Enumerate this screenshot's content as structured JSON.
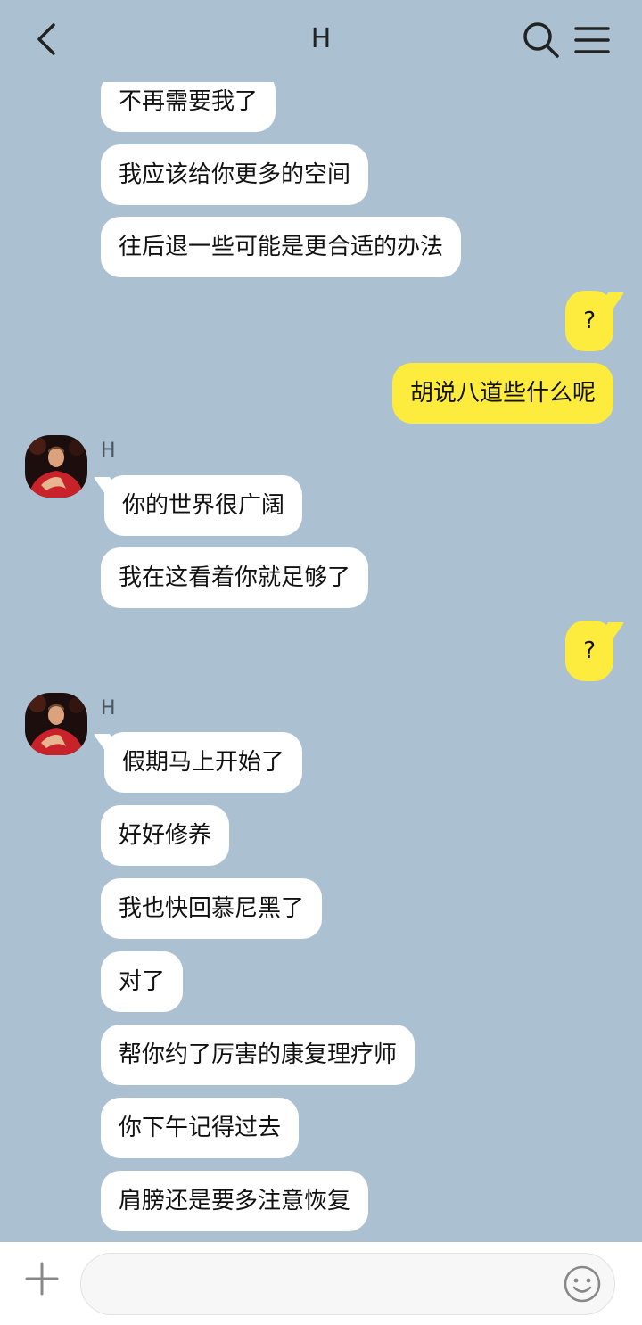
{
  "header": {
    "title": "H"
  },
  "messages": [
    {
      "text": "不再需要我了"
    },
    {
      "text": "我应该给你更多的空间"
    },
    {
      "text": "往后退一些可能是更合适的办法"
    },
    {
      "text": "?"
    },
    {
      "text": "胡说八道些什么呢"
    },
    {
      "sender": "H"
    },
    {
      "text": "你的世界很广阔"
    },
    {
      "text": "我在这看着你就足够了"
    },
    {
      "text": "?"
    },
    {
      "sender": "H"
    },
    {
      "text": "假期马上开始了"
    },
    {
      "text": "好好修养"
    },
    {
      "text": "我也快回慕尼黑了"
    },
    {
      "text": "对了"
    },
    {
      "text": "帮你约了厉害的康复理疗师"
    },
    {
      "text": "你下午记得过去"
    },
    {
      "text": "肩膀还是要多注意恢复"
    }
  ],
  "input": {
    "value": "",
    "placeholder": ""
  },
  "icons": {
    "back": "chevron-left-icon",
    "search": "search-icon",
    "menu": "menu-icon",
    "add": "plus-icon",
    "emoji": "smiley-icon",
    "avatar": "avatar-photo"
  },
  "colors": {
    "background": "#abc1d1",
    "incoming_bubble": "#ffffff",
    "outgoing_bubble": "#fdeb3d"
  }
}
